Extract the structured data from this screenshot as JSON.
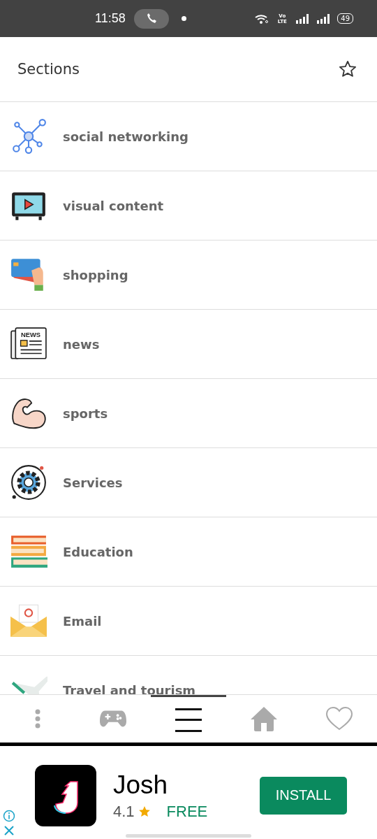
{
  "status_bar": {
    "time": "11:58",
    "network_label": "Vo LTE",
    "battery": "49"
  },
  "header": {
    "title": "Sections"
  },
  "sections": [
    {
      "kind": "network",
      "label": "social networking"
    },
    {
      "kind": "tv",
      "label": "visual content"
    },
    {
      "kind": "card",
      "label": "shopping"
    },
    {
      "kind": "newspaper",
      "label": "news",
      "icon_label": "NEWS"
    },
    {
      "kind": "arm",
      "label": "sports"
    },
    {
      "kind": "gear",
      "label": "Services"
    },
    {
      "kind": "books",
      "label": "Education"
    },
    {
      "kind": "mail",
      "label": "Email"
    },
    {
      "kind": "plane",
      "label": "Travel and tourism"
    }
  ],
  "bottom_nav": [
    {
      "kind": "more",
      "selected": false
    },
    {
      "kind": "games",
      "selected": false
    },
    {
      "kind": "menu",
      "selected": true
    },
    {
      "kind": "home",
      "selected": false
    },
    {
      "kind": "favorites",
      "selected": false
    }
  ],
  "ad": {
    "app_name": "Josh",
    "rating": "4.1",
    "price": "FREE",
    "button": "INSTALL"
  }
}
